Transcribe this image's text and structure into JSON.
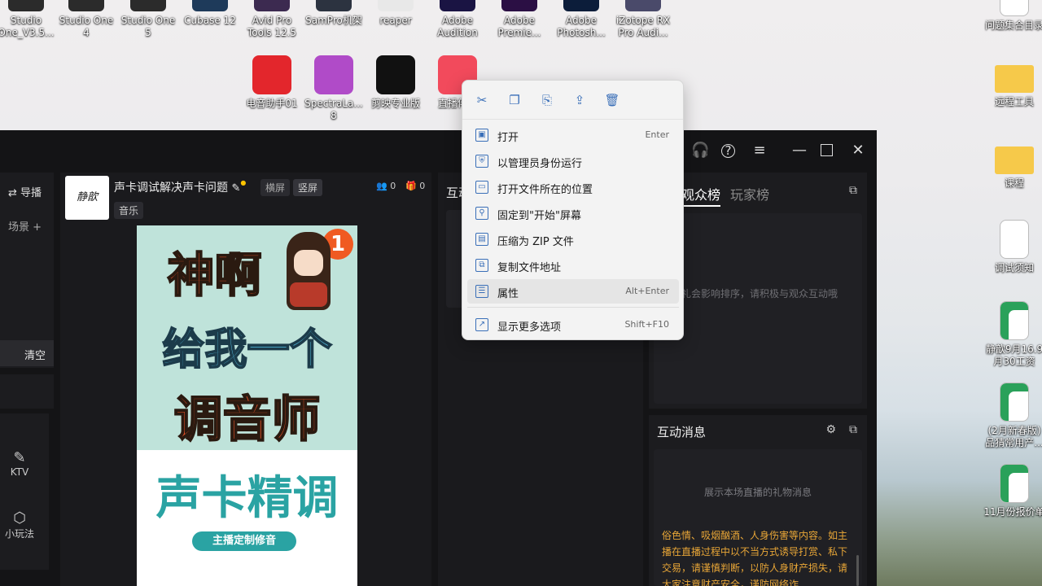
{
  "desktop_top": [
    {
      "label": "Studio One_V3.5...",
      "color": "#2b2b2b"
    },
    {
      "label": "Studio One 4",
      "color": "#2b2b2b"
    },
    {
      "label": "Studio One 5",
      "color": "#2b2b2b"
    },
    {
      "label": "Cubase 12",
      "color": "#1e3a5a"
    },
    {
      "label": "Avid Pro Tools 12.5",
      "color": "#3c2a50"
    },
    {
      "label": "SamPro机架",
      "color": "#2c3340"
    },
    {
      "label": "reaper",
      "color": "#e8e8e8"
    },
    {
      "label": "Adobe Audition",
      "color": "#1a1443"
    },
    {
      "label": "Adobe Premie...",
      "color": "#2b0f44"
    },
    {
      "label": "Adobe Photosh...",
      "color": "#0c1d3a"
    },
    {
      "label": "iZotope RX Pro Audi...",
      "color": "#4a4a6a"
    }
  ],
  "desktop_row2": [
    {
      "label": "电音助手01",
      "color": "#e3262c"
    },
    {
      "label": "SpectraLa... 8",
      "color": "#b04bc8"
    },
    {
      "label": "剪映专业版",
      "color": "#111111"
    },
    {
      "label": "直播伴侣",
      "color": "#f24a5c"
    }
  ],
  "desktop_right": [
    {
      "label": "问题集合目录",
      "kind": "doc"
    },
    {
      "label": "远程工具",
      "kind": "folder"
    },
    {
      "label": "课程",
      "kind": "folder"
    },
    {
      "label": "调试须知",
      "kind": "doc"
    },
    {
      "label": "静歆9月16.9月30工资",
      "kind": "xls"
    },
    {
      "label": "(2月新春版)品猜常用产...",
      "kind": "xls"
    },
    {
      "label": "11月份报价单",
      "kind": "xls"
    }
  ],
  "app": {
    "nav_switch": "导播",
    "scene_label": "场景",
    "clear_label": "清空",
    "nav_ktv": "KTV",
    "nav_games": "小玩法",
    "avatar_text": "静歆",
    "stream_title": "声卡调试解决声卡问题",
    "tag_landscape": "横屏",
    "tag_portrait": "竖屏",
    "tag_music": "音乐",
    "viewer_count": "0",
    "gift_count": "0",
    "interact_title_partial": "互动",
    "tab_audience": "观众榜",
    "tab_players": "玩家榜",
    "rank_hint": "加送礼会影响排序，请积极与观众互动哦",
    "messages_title": "互动消息",
    "messages_hint": "展示本场直播的礼物消息",
    "warning_text": "俗色情、吸烟酗酒、人身伤害等内容。如主播在直播过程中以不当方式诱导打赏、私下交易，请谨慎判断，以防人身财产损失，请大家注意财产安全，谨防网络诈",
    "poster": {
      "badge": "1",
      "line1": "神啊",
      "line2": "给我一个",
      "line3": "调音师",
      "line4": "声卡精调",
      "pill": "主播定制修音"
    }
  },
  "context_menu": {
    "quick_actions": [
      "cut-icon",
      "copy-icon",
      "rename-icon",
      "share-icon",
      "delete-icon"
    ],
    "items": [
      {
        "label": "打开",
        "shortcut": "Enter",
        "icon": "▣"
      },
      {
        "label": "以管理员身份运行",
        "shortcut": "",
        "icon": "⛨"
      },
      {
        "label": "打开文件所在的位置",
        "shortcut": "",
        "icon": "▭"
      },
      {
        "label": "固定到\"开始\"屏幕",
        "shortcut": "",
        "icon": "⚲"
      },
      {
        "label": "压缩为 ZIP 文件",
        "shortcut": "",
        "icon": "▤"
      },
      {
        "label": "复制文件地址",
        "shortcut": "",
        "icon": "⧉"
      },
      {
        "label": "属性",
        "shortcut": "Alt+Enter",
        "icon": "☰"
      },
      {
        "label": "显示更多选项",
        "shortcut": "Shift+F10",
        "icon": "↗"
      }
    ]
  }
}
